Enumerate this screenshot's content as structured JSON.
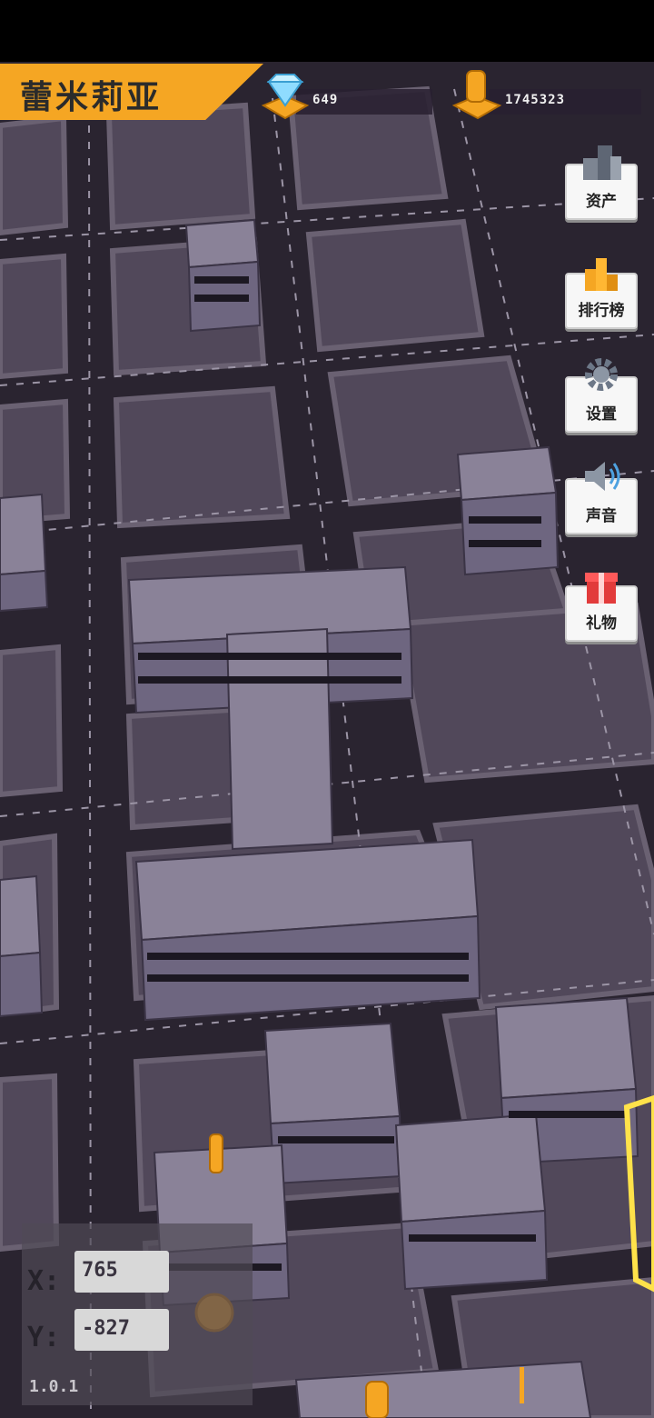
{
  "player": {
    "name": "蕾米莉亚"
  },
  "currency": {
    "gems": "649",
    "coins": "1745323"
  },
  "menu": [
    {
      "id": "assets",
      "label": "资产",
      "icon": "buildings-icon"
    },
    {
      "id": "leaderboard",
      "label": "排行榜",
      "icon": "trophy-bars-icon"
    },
    {
      "id": "settings",
      "label": "设置",
      "icon": "gear-icon"
    },
    {
      "id": "sound",
      "label": "声音",
      "icon": "speaker-icon"
    },
    {
      "id": "gift",
      "label": "礼物",
      "icon": "gift-box-icon"
    }
  ],
  "position": {
    "x_label": "X:",
    "x": "765",
    "y_label": "Y:",
    "y": "-827"
  },
  "version": "1.0.1",
  "colors": {
    "accent": "#f5a623",
    "ground": "#3b3243",
    "road": "#1f1a23",
    "lot": "#51485a",
    "building_wall": "#6e6680",
    "building_roof": "#8a8298",
    "coin": "#f5a623"
  }
}
